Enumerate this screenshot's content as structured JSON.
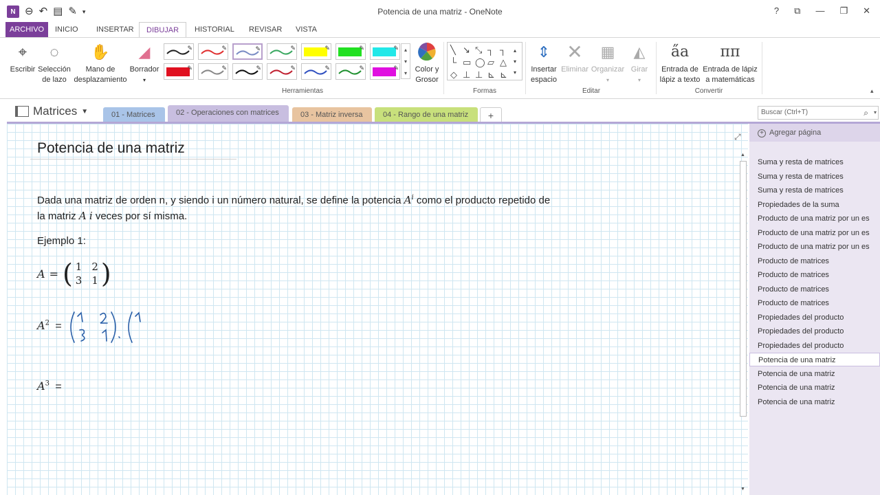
{
  "window": {
    "title": "Potencia de una matriz - OneNote",
    "controls": [
      "?",
      "⧉",
      "—",
      "❐",
      "✕"
    ]
  },
  "ribbon_tabs": [
    "ARCHIVO",
    "INICIO",
    "INSERTAR",
    "DIBUJAR",
    "HISTORIAL",
    "REVISAR",
    "VISTA"
  ],
  "active_tab": "DIBUJAR",
  "ribbon": {
    "escribir": "Escribir",
    "seleccion_1": "Selección",
    "seleccion_2": "de lazo",
    "mano_1": "Mano de",
    "mano_2": "desplazamiento",
    "borrador": "Borrador",
    "color_1": "Color y",
    "color_2": "Grosor",
    "insertar_1": "Insertar",
    "insertar_2": "espacio",
    "eliminar": "Eliminar",
    "organizar": "Organizar",
    "girar": "Girar",
    "entrada_texto_1": "Entrada de",
    "entrada_texto_2": "lápiz a texto",
    "entrada_mat_1": "Entrada de lápiz",
    "entrada_mat_2": "a matemáticas",
    "groups": {
      "herramientas": "Herramientas",
      "formas": "Formas",
      "editar": "Editar",
      "convertir": "Convertir"
    }
  },
  "pen_colors": [
    "#222222",
    "#e03030",
    "#7a8cc4",
    "#3aa860",
    "#ffff00",
    "#22e022",
    "#22e8e8",
    "#e01020",
    "#888888",
    "#111111",
    "#c02030",
    "#3050c0",
    "#209030",
    "#e010e0"
  ],
  "notebook": {
    "name": "Matrices",
    "sections": [
      {
        "label": "01 - Matrices",
        "color": "#a9c4e8"
      },
      {
        "label": "02 - Operaciones con matrices",
        "color": "#c8bee0"
      },
      {
        "label": "03 - Matriz inversa",
        "color": "#e8c4a0"
      },
      {
        "label": "04 - Rango de una matriz",
        "color": "#c8e07c"
      }
    ],
    "add_section": "+",
    "search_placeholder": "Buscar (Ctrl+T)"
  },
  "page": {
    "title": "Potencia de una matriz",
    "para_1a": "Dada una matriz de orden n, y siendo i un número natural, se define la potencia ",
    "para_1_A": "A",
    "para_1_i": "i",
    "para_1b": " como el producto repetido de",
    "para_2a": "la matriz ",
    "para_2_A": "A",
    "para_2_i": "i",
    "para_2b": " veces por sí misma.",
    "example": "Ejemplo 1:",
    "eqA_lhs": "A",
    "eqA_eq": "=",
    "matrix_A": [
      "1",
      "2",
      "3",
      "1"
    ],
    "a2_lhs": "A",
    "a2_exp": "2",
    "a2_eq": "=",
    "a3_lhs": "A",
    "a3_exp": "3",
    "a3_eq": "="
  },
  "pages_panel": {
    "add_page": "Agregar página",
    "items": [
      "Suma y resta de matrices",
      "Suma y resta de matrices",
      "Suma y resta de matrices",
      "Propiedades de la suma",
      "Producto de una matriz por un es",
      "Producto de una matriz por un es",
      "Producto de una matriz por un es",
      "Producto de matrices",
      "Producto de matrices",
      "Producto de matrices",
      "Producto de matrices",
      "Propiedades del producto",
      "Propiedades del producto",
      "Propiedades del producto",
      "Potencia de una matriz",
      "Potencia de una matriz",
      "Potencia de una matriz",
      "Potencia de una matriz"
    ],
    "selected_index": 14
  },
  "accent_color": "#7b3f9a"
}
